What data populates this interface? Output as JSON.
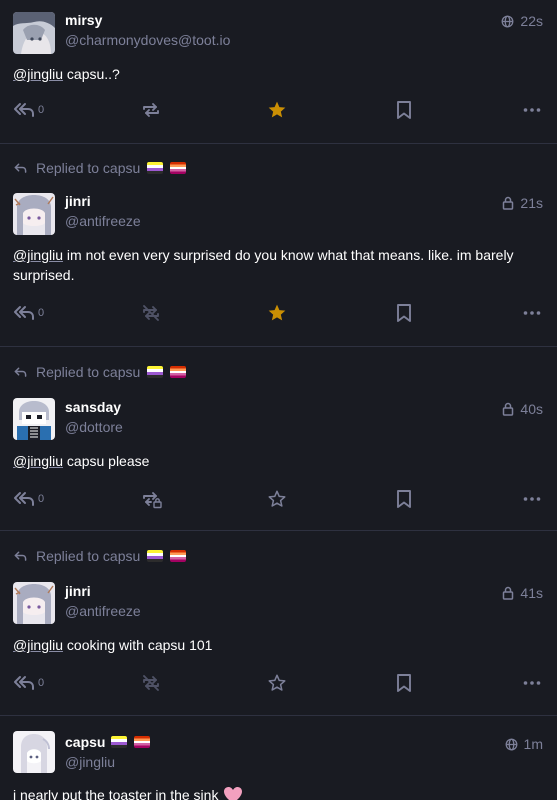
{
  "statuses": [
    {
      "display_name": "mirsy",
      "acct": "@charmonydoves@toot.io",
      "time": "22s",
      "visibility": "public",
      "mention": "@jingliu",
      "text": " capsu..?",
      "reply_count": "0",
      "boost_icon": "boost-icon",
      "favourited": true
    },
    {
      "replied_to": "Replied to capsu",
      "display_name": "jinri",
      "acct": "@antifreeze",
      "time": "21s",
      "visibility": "private",
      "mention": "@jingliu",
      "text": " im not even very surprised do you know what that means. like. im barely surprised.",
      "reply_count": "0",
      "boost_icon": "boost-disabled-icon",
      "favourited": true
    },
    {
      "replied_to": "Replied to capsu",
      "display_name": "sansday",
      "acct": "@dottore",
      "time": "40s",
      "visibility": "private",
      "mention": "@jingliu",
      "text": " capsu please",
      "reply_count": "0",
      "boost_icon": "boost-lock-icon",
      "favourited": false
    },
    {
      "replied_to": "Replied to capsu",
      "display_name": "jinri",
      "acct": "@antifreeze",
      "time": "41s",
      "visibility": "private",
      "mention": "@jingliu",
      "text": " cooking with capsu 101",
      "reply_count": "0",
      "boost_icon": "boost-disabled-icon",
      "favourited": false
    },
    {
      "display_name": "capsu",
      "acct": "@jingliu",
      "time": "1m",
      "visibility": "public",
      "text": "i nearly put the toaster in the sink"
    }
  ],
  "colors": {
    "background": "#191b22",
    "muted": "#7d8099",
    "favourite_active": "#ca8f04",
    "divider": "#2e3140"
  }
}
